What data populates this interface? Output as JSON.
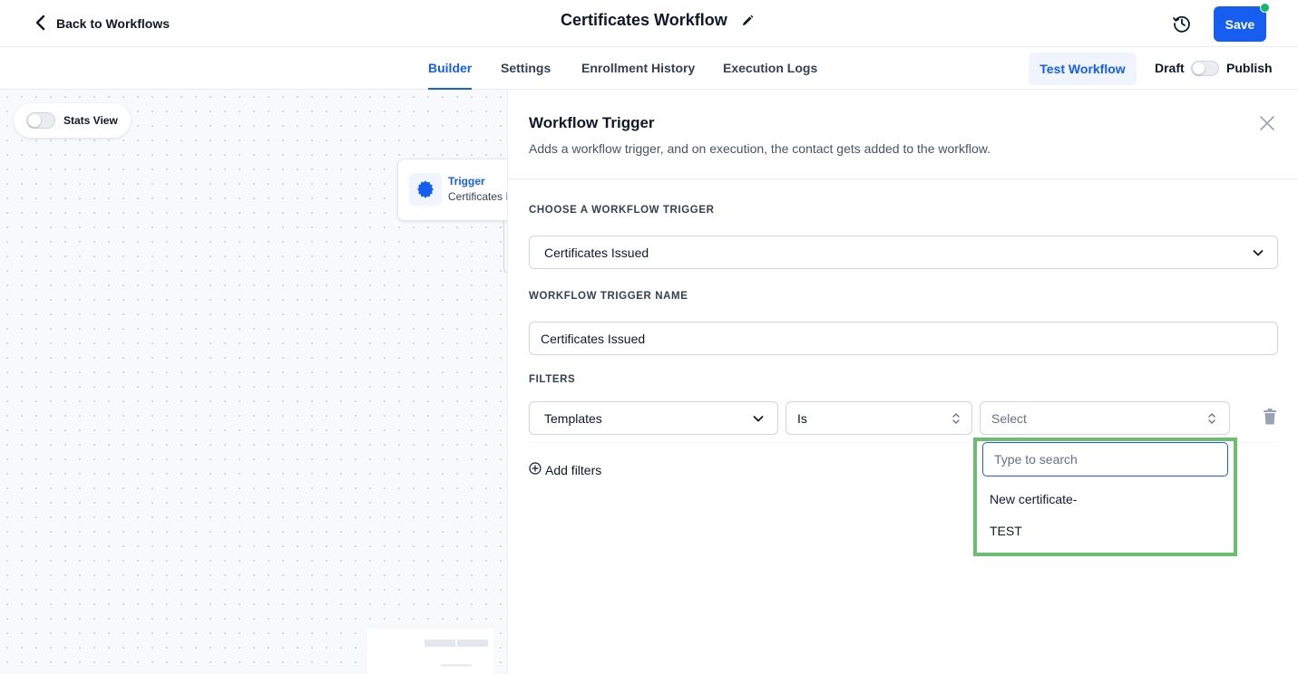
{
  "header": {
    "back_label": "Back to Workflows",
    "title": "Certificates Workflow",
    "save_label": "Save"
  },
  "tabs": [
    {
      "label": "Builder",
      "active": true
    },
    {
      "label": "Settings",
      "active": false
    },
    {
      "label": "Enrollment History",
      "active": false
    },
    {
      "label": "Execution Logs",
      "active": false
    }
  ],
  "actions": {
    "test_workflow_label": "Test Workflow",
    "draft_label": "Draft",
    "publish_label": "Publish",
    "published": false
  },
  "canvas": {
    "stats_view_label": "Stats View",
    "stats_view_on": false,
    "trigger_node": {
      "title": "Trigger",
      "subtitle": "Certificates Issued"
    }
  },
  "panel": {
    "title": "Workflow Trigger",
    "description": "Adds a workflow trigger, and on execution, the contact gets added to the workflow.",
    "choose_trigger_label": "CHOOSE A WORKFLOW TRIGGER",
    "selected_trigger": "Certificates Issued",
    "trigger_name_label": "WORKFLOW TRIGGER NAME",
    "trigger_name_value": "Certificates Issued",
    "filters_label": "FILTERS",
    "filter": {
      "field": "Templates",
      "operator": "Is",
      "value_placeholder": "Select"
    },
    "add_filters_label": "Add filters"
  },
  "dropdown": {
    "search_placeholder": "Type to search",
    "options": [
      "New certificate-",
      "TEST"
    ]
  },
  "colors": {
    "primary": "#155eef",
    "status_dot": "#12b76a",
    "highlight_border": "#6abf6e"
  }
}
